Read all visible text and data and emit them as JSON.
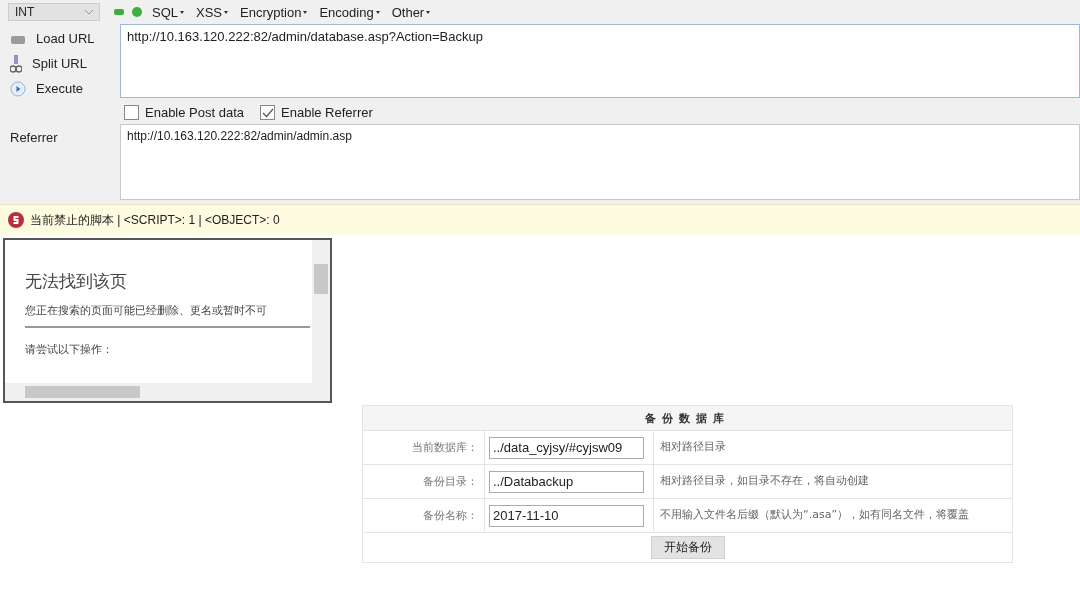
{
  "toolbar": {
    "selector": "INT",
    "menus": [
      "SQL",
      "XSS",
      "Encryption",
      "Encoding",
      "Other"
    ]
  },
  "actions": [
    {
      "kind": "load",
      "label": "Load URL"
    },
    {
      "kind": "split",
      "label": "Split URL"
    },
    {
      "kind": "execute",
      "label": "Execute"
    }
  ],
  "url": "http://10.163.120.222:82/admin/database.asp?Action=Backup",
  "options": [
    {
      "label": "Enable Post data",
      "checked": false
    },
    {
      "label": "Enable Referrer",
      "checked": true
    }
  ],
  "referrer": {
    "label": "Referrer",
    "value": "http://10.163.120.222:82/admin/admin.asp"
  },
  "script_bar": {
    "text": "当前禁止的脚本 | <SCRIPT>: 1 | <OBJECT>: 0"
  },
  "error_frame": {
    "title": "无法找到该页",
    "message": "您正在搜索的页面可能已经删除、更名或暂时不可",
    "prompt": "请尝试以下操作："
  },
  "backup_form": {
    "title": "备份数据库",
    "rows": [
      {
        "label": "当前数据库：",
        "value": "../data_cyjsy/#cyjsw09",
        "hint": "相对路径目录"
      },
      {
        "label": "备份目录：",
        "value": "../Databackup",
        "hint": "相对路径目录，如目录不存在，将自动创建"
      },
      {
        "label": "备份名称：",
        "value": "2017-11-10",
        "hint": "不用输入文件名后缀（默认为“.asa”），如有同名文件，将覆盖"
      }
    ],
    "button": "开始备份"
  }
}
